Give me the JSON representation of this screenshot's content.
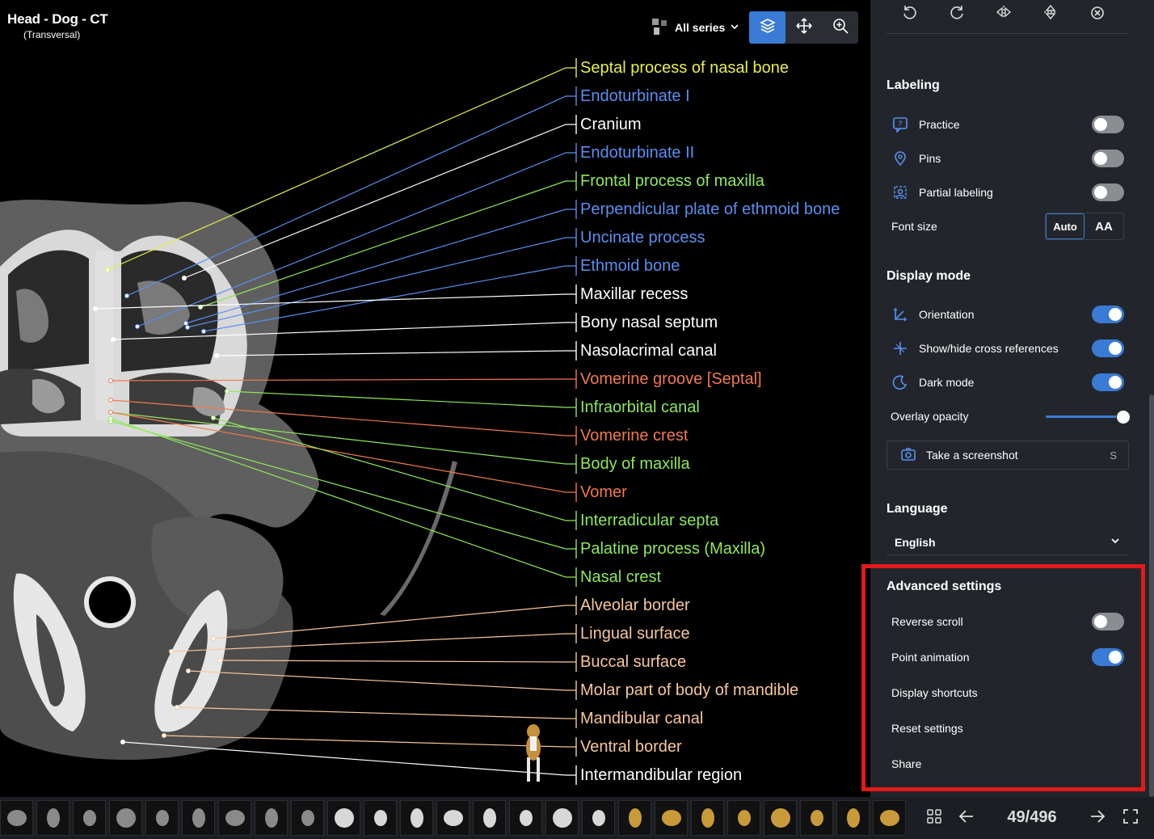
{
  "viewer": {
    "title": "Head - Dog - CT",
    "subtitle": "(Transversal)",
    "series_label": "All series",
    "tools": [
      {
        "name": "layers-icon",
        "active": true
      },
      {
        "name": "move-icon",
        "active": false
      },
      {
        "name": "zoom-in-icon",
        "active": false
      }
    ]
  },
  "labels": [
    {
      "text": "Septal process of nasal bone",
      "color": "#e6ef4a"
    },
    {
      "text": "Endoturbinate I",
      "color": "#5b8ff0"
    },
    {
      "text": "Cranium",
      "color": "#ffffff"
    },
    {
      "text": "Endoturbinate II",
      "color": "#5b8ff0"
    },
    {
      "text": "Frontal process of maxilla",
      "color": "#8fe85a"
    },
    {
      "text": "Perpendicular plate of ethmoid bone",
      "color": "#5b8ff0"
    },
    {
      "text": "Uncinate process",
      "color": "#5b8ff0"
    },
    {
      "text": "Ethmoid bone",
      "color": "#5b8ff0"
    },
    {
      "text": "Maxillar recess",
      "color": "#ffffff"
    },
    {
      "text": "Bony nasal septum",
      "color": "#ffffff"
    },
    {
      "text": "Nasolacrimal canal",
      "color": "#ffffff"
    },
    {
      "text": "Vomerine groove [Septal]",
      "color": "#f07a4e"
    },
    {
      "text": "Infraorbital canal",
      "color": "#8fe85a"
    },
    {
      "text": "Vomerine crest",
      "color": "#f07a4e"
    },
    {
      "text": "Body of maxilla",
      "color": "#8fe85a"
    },
    {
      "text": "Vomer",
      "color": "#f07a4e"
    },
    {
      "text": "Interradicular septa",
      "color": "#8fe85a"
    },
    {
      "text": "Palatine process (Maxilla)",
      "color": "#8fe85a"
    },
    {
      "text": "Nasal crest",
      "color": "#8fe85a"
    },
    {
      "text": "Alveolar border",
      "color": "#f7c79a"
    },
    {
      "text": "Lingual surface",
      "color": "#f7c79a"
    },
    {
      "text": "Buccal surface",
      "color": "#f7c79a"
    },
    {
      "text": "Molar part of body of mandible",
      "color": "#f7c79a"
    },
    {
      "text": "Mandibular canal",
      "color": "#f7c79a"
    },
    {
      "text": "Ventral border",
      "color": "#f7c79a"
    },
    {
      "text": "Intermandibular region",
      "color": "#ffffff"
    }
  ],
  "panel": {
    "rotation_tools": [
      "rotate-left-icon",
      "rotate-right-icon",
      "flip-horizontal-icon",
      "flip-vertical-icon",
      "reset-rotation-icon"
    ],
    "labeling": {
      "title": "Labeling",
      "practice": {
        "label": "Practice",
        "on": false
      },
      "pins": {
        "label": "Pins",
        "on": false
      },
      "partial": {
        "label": "Partial labeling",
        "on": false
      },
      "font_size": {
        "label": "Font size",
        "auto": "Auto",
        "large": "AA"
      }
    },
    "display_mode": {
      "title": "Display mode",
      "orientation": {
        "label": "Orientation",
        "on": true
      },
      "cross_refs": {
        "label": "Show/hide cross references",
        "on": true
      },
      "dark_mode": {
        "label": "Dark mode",
        "on": true
      },
      "overlay_opacity": {
        "label": "Overlay opacity",
        "value": 1.0
      }
    },
    "screenshot": {
      "label": "Take a screenshot",
      "shortcut": "S"
    },
    "language": {
      "title": "Language",
      "value": "English"
    },
    "advanced": {
      "title": "Advanced settings",
      "reverse_scroll": {
        "label": "Reverse scroll",
        "on": false
      },
      "point_animation": {
        "label": "Point animation",
        "on": true
      },
      "display_shortcuts": "Display shortcuts",
      "reset_settings": "Reset settings",
      "share": "Share"
    }
  },
  "bottombar": {
    "slice_counter": "49/496",
    "thumbnail_count": 25
  },
  "colors": {
    "accent": "#3a7bd5",
    "panel_bg": "#22262c",
    "highlight": "#e01b1b"
  }
}
